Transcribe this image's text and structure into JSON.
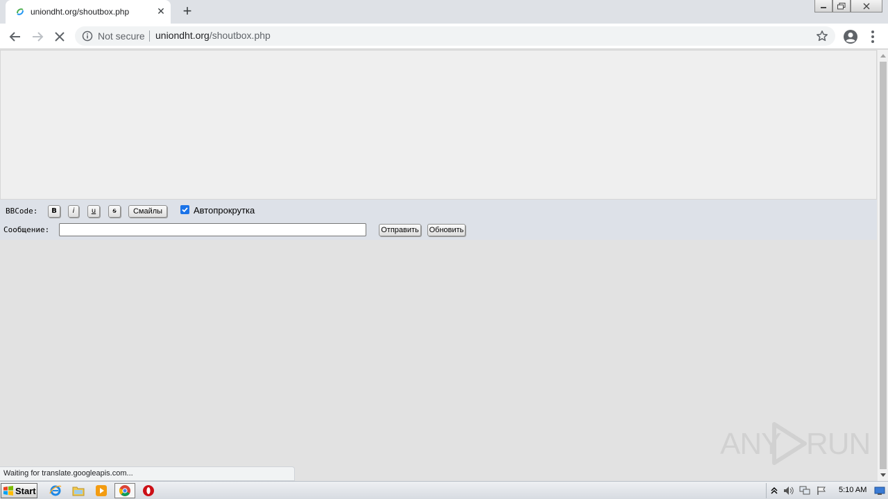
{
  "browser": {
    "tab": {
      "title": "uniondht.org/shoutbox.php",
      "close_glyph": "✕"
    },
    "new_tab_glyph": "+",
    "omnibox": {
      "security_label": "Not secure",
      "url_host": "uniondht.org",
      "url_path": "/shoutbox.php"
    },
    "status_text": "Waiting for translate.googleapis.com..."
  },
  "page": {
    "bbcode_label": "BBCode:",
    "bbcode_buttons": {
      "bold": "B",
      "italic": "i",
      "underline": "u",
      "strike": "s"
    },
    "smiles_button": "Смайлы",
    "autoscroll": {
      "label": "Автопрокрутка",
      "checked": true
    },
    "message_label": "Сообщение:",
    "message_value": "",
    "send_button": "Отправить",
    "refresh_button": "Обновить"
  },
  "watermark": {
    "left": "ANY",
    "right": "RUN"
  },
  "taskbar": {
    "start_label": "Start",
    "pinned": [
      "internet-explorer-icon",
      "file-explorer-icon",
      "media-player-icon",
      "chrome-icon",
      "opera-icon"
    ],
    "clock": "5:10 AM"
  },
  "colors": {
    "tabstrip": "#dee1e6",
    "page_frame": "#efefef",
    "controls_bar": "#dde1e8",
    "checkbox_accent": "#1a73e8"
  }
}
